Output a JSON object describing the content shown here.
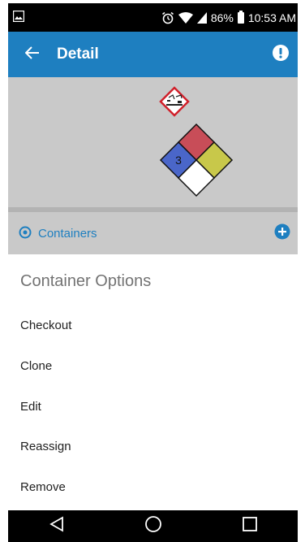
{
  "status_bar": {
    "battery_percent": "86%",
    "time": "10:53 AM",
    "icons": [
      "photo-notification-icon",
      "alarm-icon",
      "wifi-icon",
      "signal-icon",
      "battery-icon"
    ]
  },
  "app_bar": {
    "title": "Detail",
    "back_icon": "arrow-back-icon",
    "action_icon": "alert-circle-icon",
    "color": "#1e7fc0"
  },
  "hazard": {
    "ghs_pictogram": "corrosive-pictogram-icon",
    "nfpa_diamond": {
      "health": "3",
      "flammability": "",
      "reactivity": "",
      "special": "",
      "colors": {
        "health": "#4a66c9",
        "flammability": "#c84d58",
        "reactivity": "#c8c84a",
        "special": "#ffffff"
      }
    }
  },
  "containers": {
    "label": "Containers",
    "add_icon": "add-circle-icon",
    "color": "#1e7fc0"
  },
  "sheet": {
    "title": "Container Options",
    "options": [
      "Checkout",
      "Clone",
      "Edit",
      "Reassign",
      "Remove"
    ]
  },
  "nav_bar": {
    "icons": [
      "back-triangle-icon",
      "home-circle-icon",
      "recents-square-icon"
    ]
  }
}
